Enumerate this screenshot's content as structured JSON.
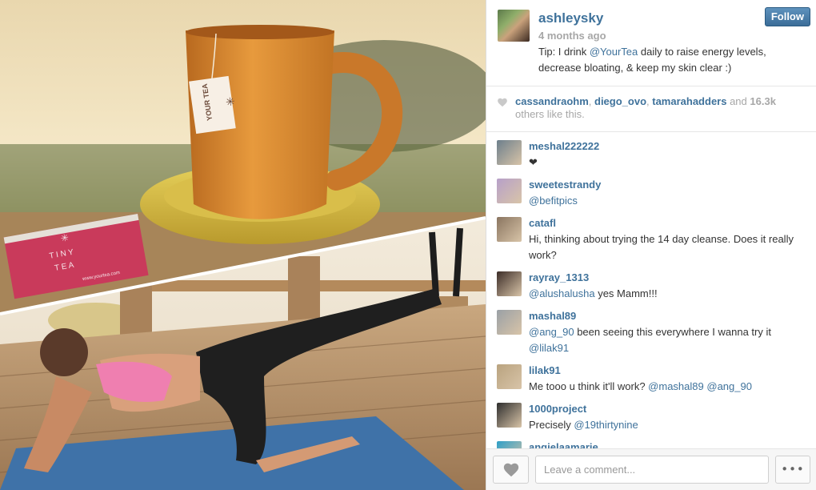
{
  "post": {
    "username": "ashleysky",
    "time": "4 months ago",
    "follow_label": "Follow",
    "caption": {
      "before": "Tip: I drink ",
      "mention": "@YourTea",
      "after": " daily to raise energy levels, decrease bloating, & keep my skin clear :)"
    }
  },
  "photo": {
    "mug_tag_text": "YOUR TEA",
    "box_brand": "T I N Y",
    "box_brand_2": "T E A",
    "box_url": "www.yourtea.com"
  },
  "likes": {
    "users": [
      "cassandraohm",
      "diego_ovo",
      "tamarahadders"
    ],
    "separator": ", ",
    "and_text": " and ",
    "count": "16.3k",
    "suffix": " others like this."
  },
  "comments": [
    {
      "user": "meshal222222",
      "parts": [
        {
          "t": "❤",
          "m": false
        }
      ],
      "avatar": "#6d7f8c"
    },
    {
      "user": "sweetestrandy",
      "parts": [
        {
          "t": "@befitpics",
          "m": true
        }
      ],
      "avatar": "#b7a0c9"
    },
    {
      "user": "catafl",
      "parts": [
        {
          "t": "Hi, thinking about trying the 14 day cleanse. Does it really work?",
          "m": false
        }
      ],
      "avatar": "#8a7560"
    },
    {
      "user": "rayray_1313",
      "parts": [
        {
          "t": "@alushalusha",
          "m": true
        },
        {
          "t": " yes Mamm!!!",
          "m": false
        }
      ],
      "avatar": "#3c2d28"
    },
    {
      "user": "mashal89",
      "parts": [
        {
          "t": "@ang_90",
          "m": true
        },
        {
          "t": " been seeing this everywhere I wanna try it ",
          "m": false
        },
        {
          "t": "@lilak91",
          "m": true
        }
      ],
      "avatar": "#9aa0a6"
    },
    {
      "user": "lilak91",
      "parts": [
        {
          "t": "Me tooo u think it'll work? ",
          "m": false
        },
        {
          "t": "@mashal89",
          "m": true
        },
        {
          "t": " ",
          "m": false
        },
        {
          "t": "@ang_90",
          "m": true
        }
      ],
      "avatar": "#b9a37f"
    },
    {
      "user": "1000project",
      "parts": [
        {
          "t": "Precisely ",
          "m": false
        },
        {
          "t": "@19thirtynine",
          "m": true
        }
      ],
      "avatar": "#2e2e2e"
    },
    {
      "user": "angielaamarie",
      "parts": [],
      "avatar": "#2f9fc7"
    }
  ],
  "footer": {
    "comment_placeholder": "Leave a comment...",
    "more_label": "•••"
  },
  "colors": {
    "link": "#3f729b",
    "follow_button": "#4a7ba6",
    "muted": "#a7a7a7"
  }
}
